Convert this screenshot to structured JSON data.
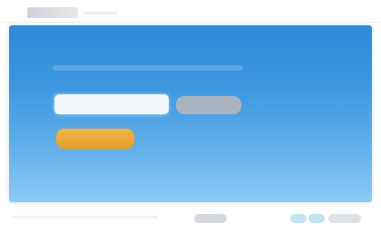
{
  "header": {
    "logo_icon": "site-logo-icon"
  },
  "hero": {
    "title": "",
    "email_input": {
      "value": "",
      "placeholder": ""
    },
    "submit_label": "",
    "cta_label": ""
  },
  "colors": {
    "hero_top": "#2e8bd8",
    "hero_bottom": "#8ccaf4",
    "cta": "#f2b44a",
    "submit": "#a9b3bf"
  },
  "footer": {
    "text": "",
    "links": [
      "",
      "",
      "",
      ""
    ]
  }
}
